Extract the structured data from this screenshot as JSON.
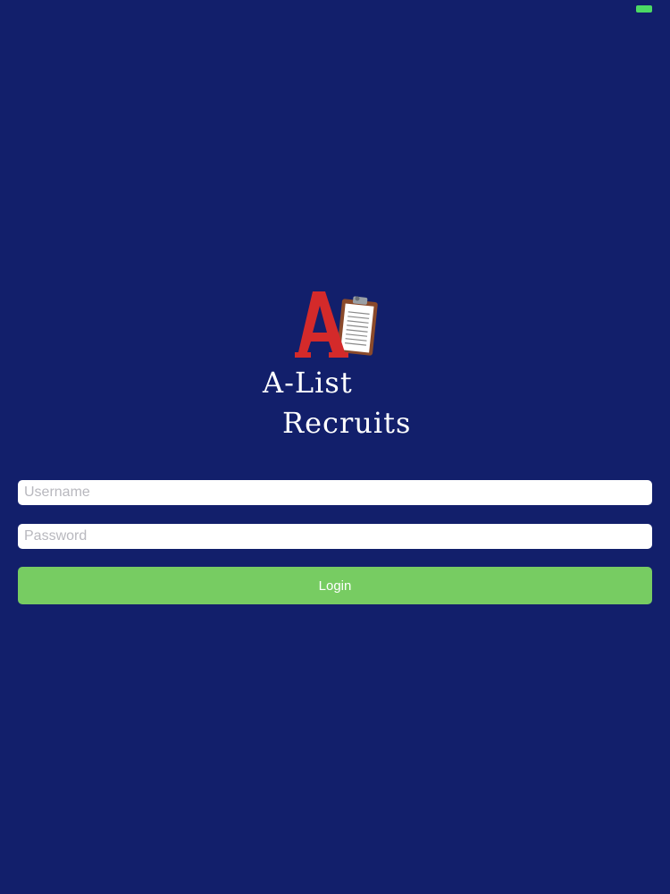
{
  "status_bar": {
    "battery_icon": "battery-icon",
    "battery_color": "#4cd964"
  },
  "logo": {
    "line1": "A-List",
    "line2": "Recruits",
    "icon": "clipboard-icon",
    "letter_color": "#d42a2a"
  },
  "form": {
    "username_placeholder": "Username",
    "password_placeholder": "Password",
    "login_label": "Login"
  },
  "colors": {
    "background": "#121f6b",
    "button": "#77cc62"
  }
}
